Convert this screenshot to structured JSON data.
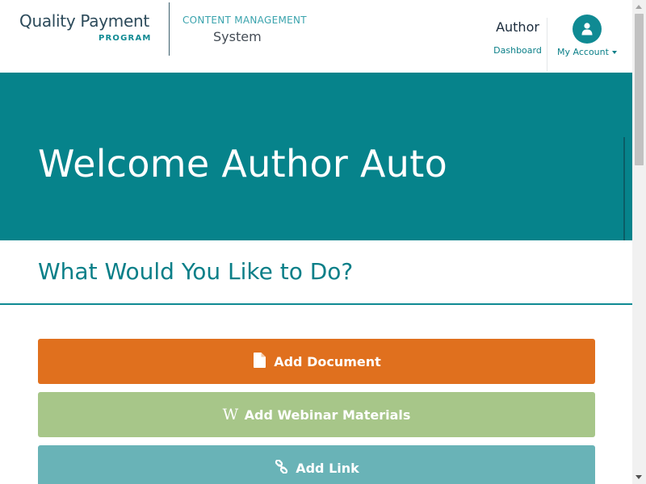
{
  "header": {
    "logo_qpp_line1": "Quality Payment",
    "logo_qpp_line2": "PROGRAM",
    "logo_cms_line1": "CONTENT MANAGEMENT",
    "logo_cms_line2": "System",
    "author_title": "Author",
    "dashboard_link": "Dashboard",
    "account_label": "My Account"
  },
  "hero": {
    "title": "Welcome Author Auto"
  },
  "main": {
    "subtitle": "What Would You Like to Do?",
    "actions": [
      {
        "label": "Add Document",
        "icon": "file-icon",
        "color": "#e0701e"
      },
      {
        "label": "Add Webinar Materials",
        "icon": "wikipedia-w-icon",
        "color": "#a7c689"
      },
      {
        "label": "Add Link",
        "icon": "link-icon",
        "color": "#69b3b7"
      }
    ]
  },
  "colors": {
    "brand_teal": "#06838b",
    "accent_teal": "#0a7f88"
  }
}
